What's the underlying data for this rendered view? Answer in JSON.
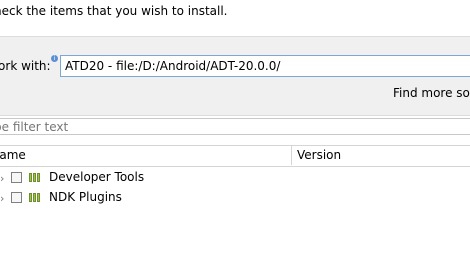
{
  "intro": "heck the items that you wish to install.",
  "work_with": {
    "label": "/ork with:",
    "value": "ATD20 - file:/D:/Android/ADT-20.0.0/",
    "info_badge": "i"
  },
  "find_more": "Find more so",
  "filter": {
    "placeholder": "pe filter text"
  },
  "table": {
    "headers": {
      "name": "lame",
      "version": "Version"
    },
    "rows": [
      {
        "label": "Developer Tools",
        "version": "",
        "checked": false
      },
      {
        "label": "NDK Plugins",
        "version": "",
        "checked": false
      }
    ]
  },
  "colors": {
    "input_border": "#7fa6d9",
    "band": "#f0f0f0",
    "package_icon": "#9cc34a"
  },
  "icons": {
    "expand": "expand-arrow-icon",
    "package": "package-icon",
    "info": "info-icon"
  }
}
